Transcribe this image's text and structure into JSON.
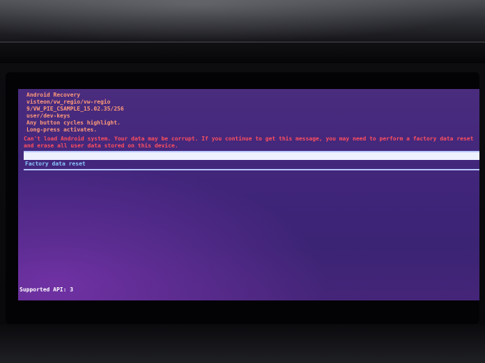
{
  "recovery": {
    "header_lines": [
      "Android Recovery",
      "visteon/vw_regio/vw-regio",
      "9/VW_PIE_CSAMPLE_15.02.35/256",
      "user/dev-keys",
      "Any button cycles highlight.",
      "Long-press activates."
    ],
    "warning": "Can't load Android system. Your data may be corrupt. If you continue to get this message, you may need to perform a factory data reset and erase all user data stored on this device.",
    "menu": {
      "highlighted_item": "",
      "items": [
        "Factory data reset"
      ]
    },
    "footer": "Supported API: 3"
  },
  "colors": {
    "background": "#40257a",
    "header_text": "#ff9a7a",
    "warning_text": "#ff4f5e",
    "menu_text": "#8ac8ff",
    "highlight": "#eef1ff",
    "footer_text": "#ffffff"
  }
}
